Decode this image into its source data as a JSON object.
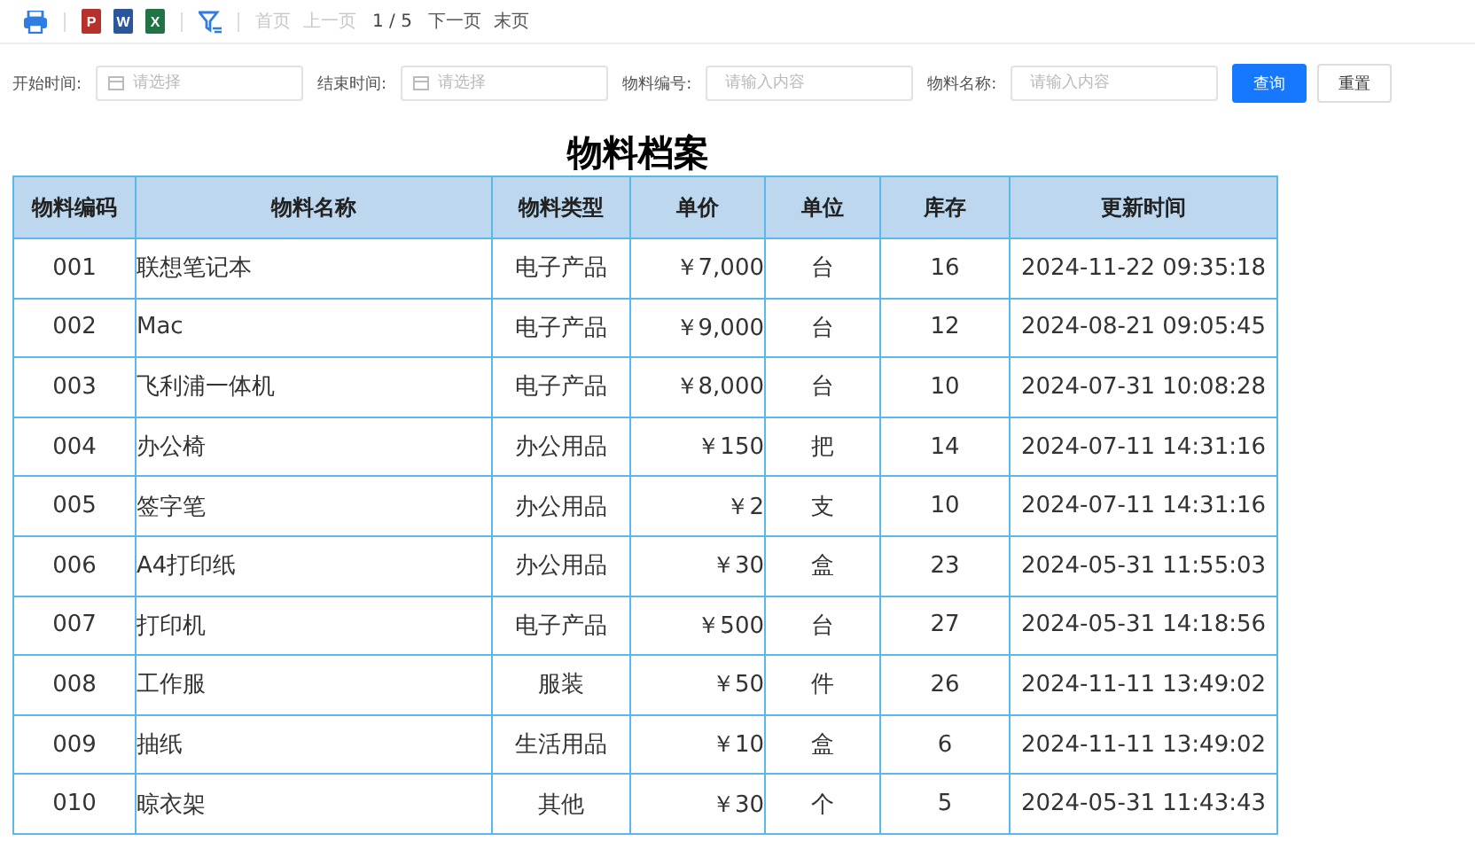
{
  "toolbar": {
    "exports": [
      {
        "kind": "ppt",
        "letter": "P"
      },
      {
        "kind": "word",
        "letter": "W"
      },
      {
        "kind": "excel",
        "letter": "X"
      }
    ],
    "pager": [
      {
        "label": "首页",
        "disabled": true
      },
      {
        "label": "上一页",
        "disabled": true
      }
    ],
    "page": "1 / 5",
    "pager_next": [
      {
        "label": "下一页",
        "disabled": false
      },
      {
        "label": "末页",
        "disabled": false
      }
    ]
  },
  "filters": [
    {
      "kind": "date",
      "label": "开始时间:",
      "placeholder": "请选择"
    },
    {
      "kind": "date",
      "label": "结束时间:",
      "placeholder": "请选择"
    },
    {
      "kind": "text",
      "label": "物料编号:",
      "placeholder": "请输入内容"
    },
    {
      "kind": "text",
      "label": "物料名称:",
      "placeholder": "请输入内容"
    }
  ],
  "buttons": [
    {
      "kind": "primary",
      "label": "查询"
    },
    {
      "kind": "default",
      "label": "重置"
    }
  ],
  "table": {
    "title": "物料档案",
    "columns": [
      "物料编码",
      "物料名称",
      "物料类型",
      "单价",
      "单位",
      "库存",
      "更新时间"
    ],
    "rows": [
      [
        "001",
        "联想笔记本",
        "电子产品",
        "￥7,000",
        "台",
        "16",
        "2024-11-22 09:35:18"
      ],
      [
        "002",
        "Mac",
        "电子产品",
        "￥9,000",
        "台",
        "12",
        "2024-08-21 09:05:45"
      ],
      [
        "003",
        "飞利浦一体机",
        "电子产品",
        "￥8,000",
        "台",
        "10",
        "2024-07-31 10:08:28"
      ],
      [
        "004",
        "办公椅",
        "办公用品",
        "￥150",
        "把",
        "14",
        "2024-07-11 14:31:16"
      ],
      [
        "005",
        "签字笔",
        "办公用品",
        "￥2",
        "支",
        "10",
        "2024-07-11 14:31:16"
      ],
      [
        "006",
        "A4打印纸",
        "办公用品",
        "￥30",
        "盒",
        "23",
        "2024-05-31 11:55:03"
      ],
      [
        "007",
        "打印机",
        "电子产品",
        "￥500",
        "台",
        "27",
        "2024-05-31 14:18:56"
      ],
      [
        "008",
        "工作服",
        "服装",
        "￥50",
        "件",
        "26",
        "2024-11-11 13:49:02"
      ],
      [
        "009",
        "抽纸",
        "生活用品",
        "￥10",
        "盒",
        "6",
        "2024-11-11 13:49:02"
      ],
      [
        "010",
        "晾衣架",
        "其他",
        "￥30",
        "个",
        "5",
        "2024-05-31 11:43:43"
      ]
    ]
  }
}
